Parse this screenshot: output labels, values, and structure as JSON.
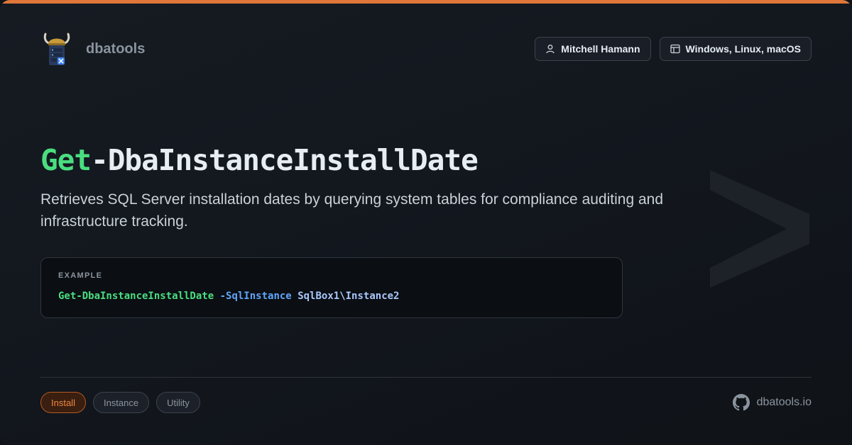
{
  "brand": {
    "name": "dbatools",
    "logo_icon": "viking-helmet-server-icon"
  },
  "meta": {
    "author": {
      "icon": "user-icon",
      "label": "Mitchell Hamann"
    },
    "platforms": {
      "icon": "window-icon",
      "label": "Windows, Linux, macOS"
    }
  },
  "command": {
    "verb": "Get",
    "noun": "-DbaInstanceInstallDate"
  },
  "description": "Retrieves SQL Server installation dates by querying system tables for compliance auditing and infrastructure tracking.",
  "example": {
    "label": "EXAMPLE",
    "command": "Get-DbaInstanceInstallDate",
    "parameter": "-SqlInstance",
    "value": "SqlBox1\\Instance2"
  },
  "tags": [
    {
      "label": "Install",
      "active": true
    },
    {
      "label": "Instance",
      "active": false
    },
    {
      "label": "Utility",
      "active": false
    }
  ],
  "footer": {
    "icon": "github-icon",
    "site": "dbatools.io"
  },
  "colors": {
    "accent": "#e0773a",
    "verb": "#4ade80",
    "parameter": "#60a5fa"
  }
}
